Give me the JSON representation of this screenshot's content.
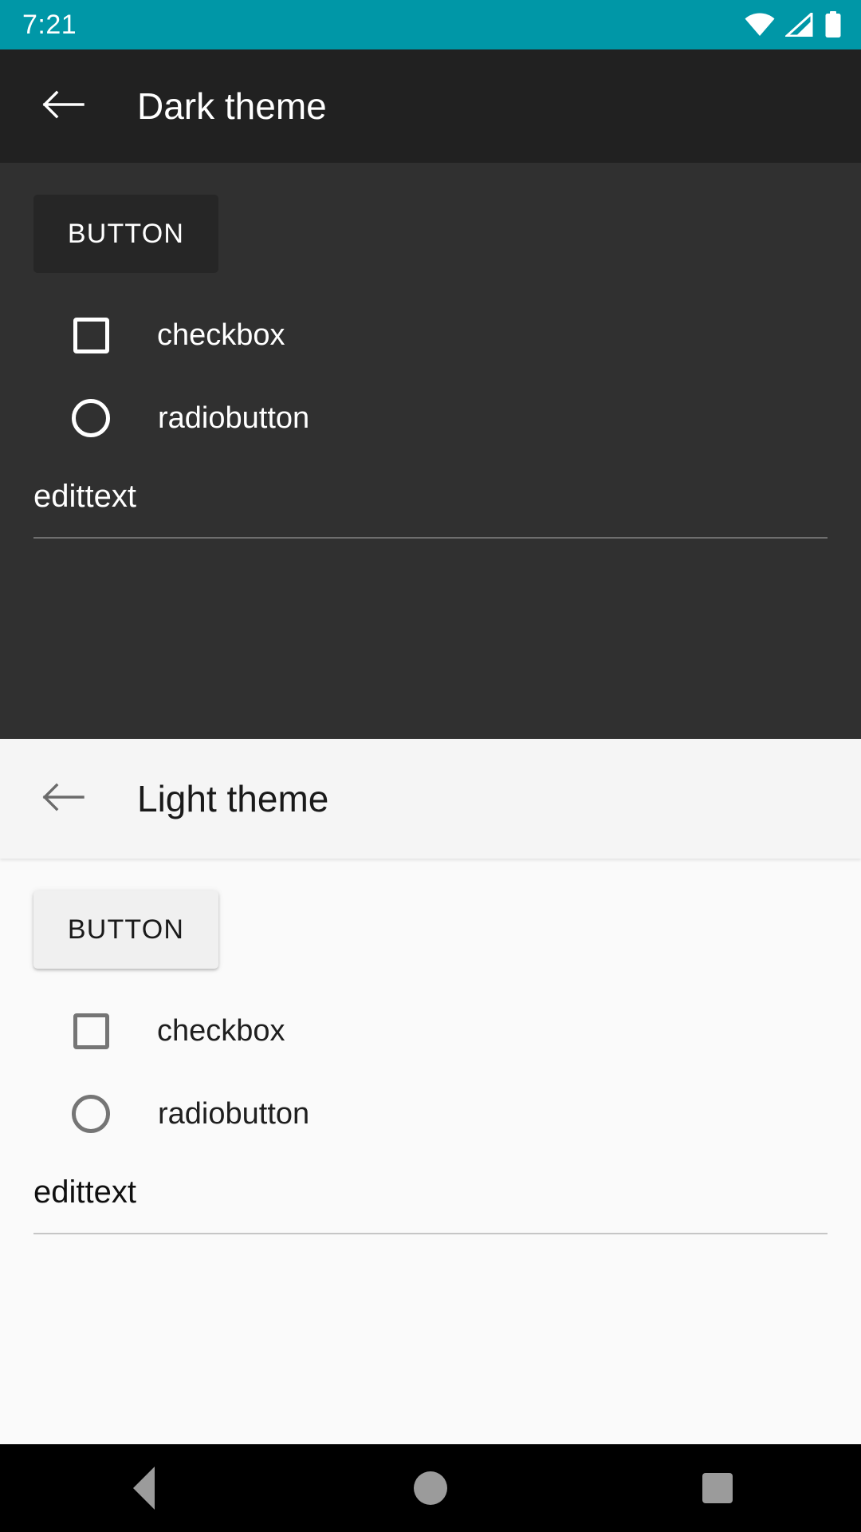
{
  "status_bar": {
    "time": "7:21",
    "background_color": "#0097A7",
    "icons": [
      "wifi-icon",
      "cellular-signal-icon",
      "battery-icon"
    ]
  },
  "dark_theme": {
    "appbar": {
      "back_icon": "arrow-back-icon",
      "title": "Dark theme",
      "background_color": "#212121",
      "text_color": "#FFFFFF"
    },
    "content_background_color": "#303030",
    "button": {
      "label": "BUTTON",
      "background_color": "#262626",
      "text_color": "#FFFFFF"
    },
    "checkbox": {
      "label": "checkbox",
      "checked": false,
      "outline_color": "#FFFFFF"
    },
    "radiobutton": {
      "label": "radiobutton",
      "selected": false,
      "outline_color": "#FFFFFF"
    },
    "edittext": {
      "value": "edittext",
      "placeholder": "edittext",
      "text_color": "#FFFFFF",
      "underline_color": "#6E6E6E"
    }
  },
  "light_theme": {
    "appbar": {
      "back_icon": "arrow-back-icon",
      "title": "Light theme",
      "background_color": "#F5F5F5",
      "text_color": "#1A1A1A"
    },
    "content_background_color": "#FAFAFA",
    "button": {
      "label": "BUTTON",
      "background_color": "#F0F0F0",
      "text_color": "#1A1A1A"
    },
    "checkbox": {
      "label": "checkbox",
      "checked": false,
      "outline_color": "#757575"
    },
    "radiobutton": {
      "label": "radiobutton",
      "selected": false,
      "outline_color": "#757575"
    },
    "edittext": {
      "value": "edittext",
      "placeholder": "edittext",
      "text_color": "#101010",
      "underline_color": "#C6C6C6"
    }
  },
  "navigation_bar": {
    "background_color": "#000000",
    "icon_color": "#9B9B9B",
    "buttons": [
      {
        "name": "back",
        "icon": "triangle-back-icon"
      },
      {
        "name": "home",
        "icon": "circle-home-icon"
      },
      {
        "name": "recents",
        "icon": "square-recents-icon"
      }
    ]
  }
}
